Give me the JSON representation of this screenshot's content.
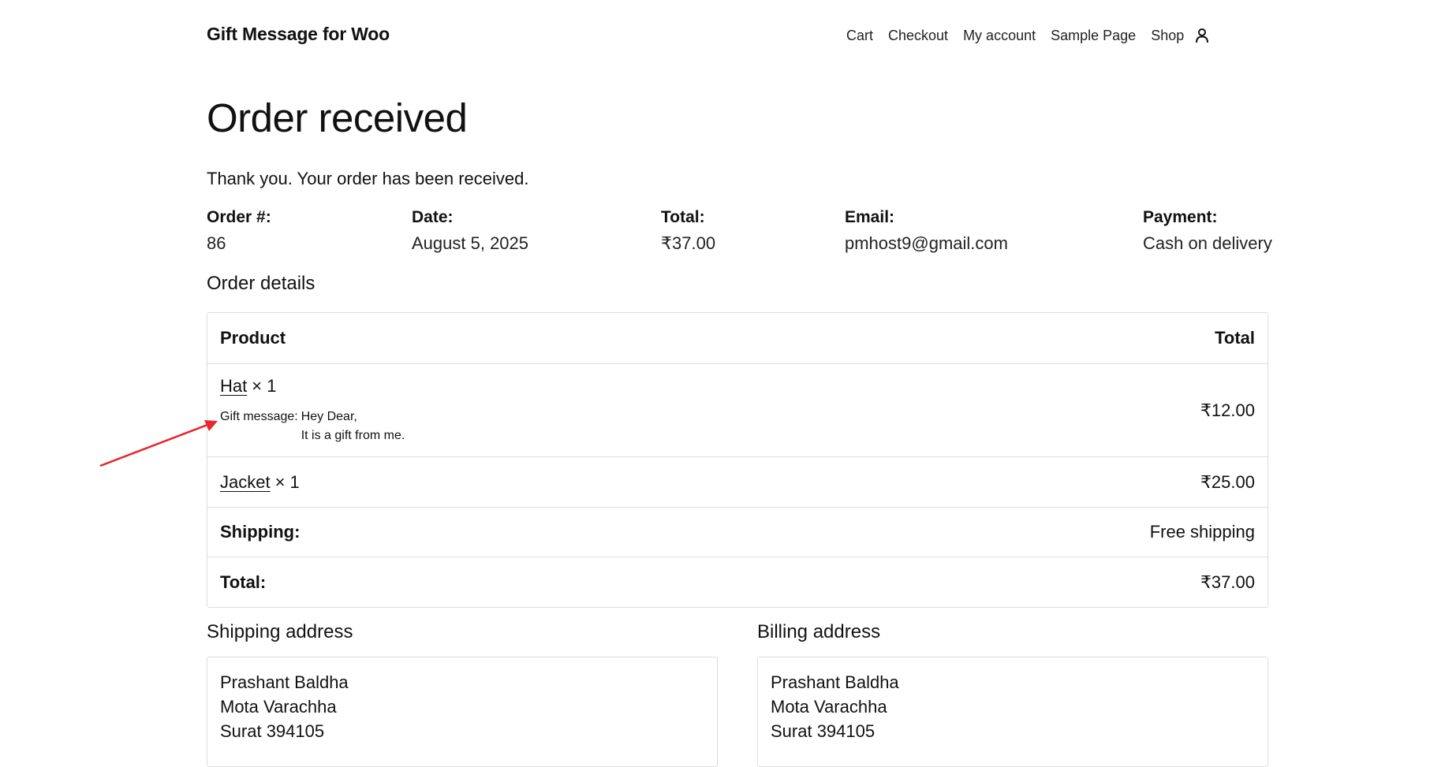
{
  "site": {
    "title": "Gift Message for Woo"
  },
  "nav": {
    "items": [
      "Cart",
      "Checkout",
      "My account",
      "Sample Page",
      "Shop"
    ]
  },
  "page": {
    "title": "Order received",
    "thanks": "Thank you. Your order has been received."
  },
  "overview": {
    "order_label": "Order #:",
    "order_value": "86",
    "date_label": "Date:",
    "date_value": "August 5, 2025",
    "total_label": "Total:",
    "total_value": "₹37.00",
    "email_label": "Email:",
    "email_value": "pmhost9@gmail.com",
    "payment_label": "Payment:",
    "payment_value": "Cash on delivery"
  },
  "order_details": {
    "title": "Order details",
    "col_product": "Product",
    "col_total": "Total",
    "items": [
      {
        "name": "Hat",
        "qty": "× 1",
        "total": "₹12.00",
        "gift_label": "Gift message:",
        "gift_line1": "Hey Dear,",
        "gift_line2": "It is a gift from me."
      },
      {
        "name": "Jacket",
        "qty": "× 1",
        "total": "₹25.00"
      }
    ],
    "shipping_label": "Shipping:",
    "shipping_value": "Free shipping",
    "total_label": "Total:",
    "total_value": "₹37.00"
  },
  "shipping_address": {
    "title": "Shipping address",
    "lines": [
      "Prashant Baldha",
      "Mota Varachha",
      "Surat 394105"
    ]
  },
  "billing_address": {
    "title": "Billing address",
    "lines": [
      "Prashant Baldha",
      "Mota Varachha",
      "Surat 394105"
    ]
  },
  "colors": {
    "annotation_arrow": "#e8262b",
    "border": "#dddddd"
  }
}
